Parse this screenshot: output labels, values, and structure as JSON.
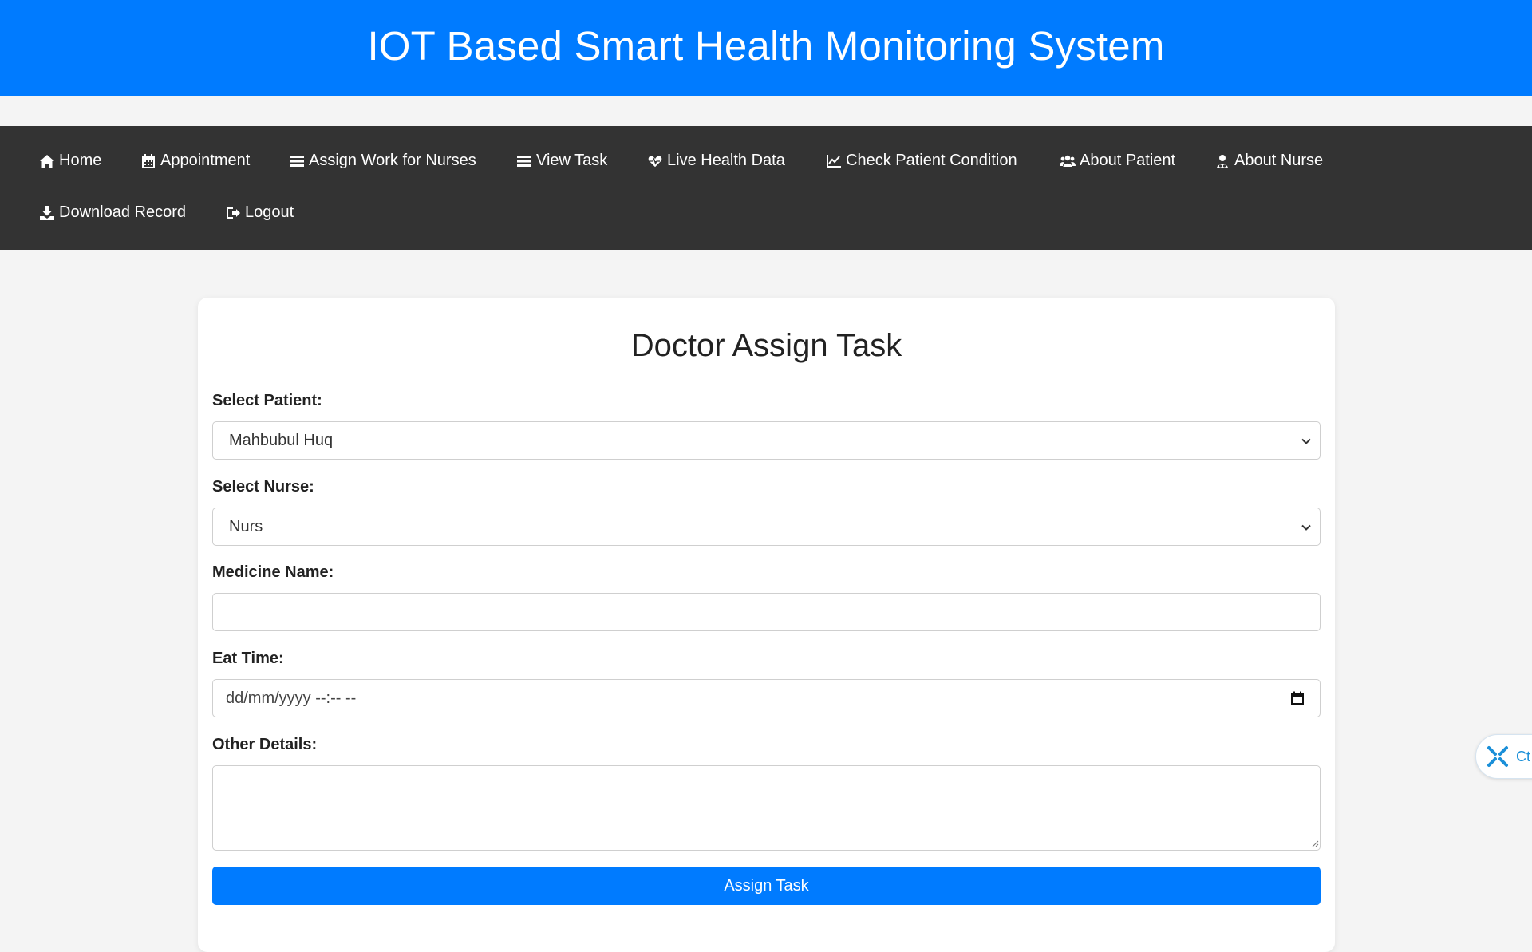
{
  "header": {
    "title": "IOT Based Smart Health Monitoring System"
  },
  "nav": {
    "items": [
      {
        "label": "Home",
        "icon": "home-icon"
      },
      {
        "label": "Appointment",
        "icon": "calendar-icon"
      },
      {
        "label": "Assign Work for Nurses",
        "icon": "list-icon"
      },
      {
        "label": "View Task",
        "icon": "list-icon"
      },
      {
        "label": "Live Health Data",
        "icon": "heartbeat-icon"
      },
      {
        "label": "Check Patient Condition",
        "icon": "line-chart-icon"
      },
      {
        "label": "About Patient",
        "icon": "users-icon"
      },
      {
        "label": "About Nurse",
        "icon": "user-nurse-icon"
      },
      {
        "label": "Download Record",
        "icon": "download-icon"
      },
      {
        "label": "Logout",
        "icon": "sign-out-icon"
      }
    ]
  },
  "form": {
    "title": "Doctor Assign Task",
    "patient_label": "Select Patient:",
    "patient_value": "Mahbubul Huq",
    "nurse_label": "Select Nurse:",
    "nurse_value": "Nurs",
    "medicine_label": "Medicine Name:",
    "medicine_value": "",
    "eat_time_label": "Eat Time:",
    "eat_time_placeholder": "dd/mm/yyyy --:-- --",
    "details_label": "Other Details:",
    "details_value": "",
    "submit_label": "Assign Task"
  },
  "widget": {
    "label": "Ct",
    "icon": "extension-icon"
  },
  "colors": {
    "primary": "#007bff",
    "nav_bg": "#333333",
    "page_bg": "#f4f4f4"
  }
}
